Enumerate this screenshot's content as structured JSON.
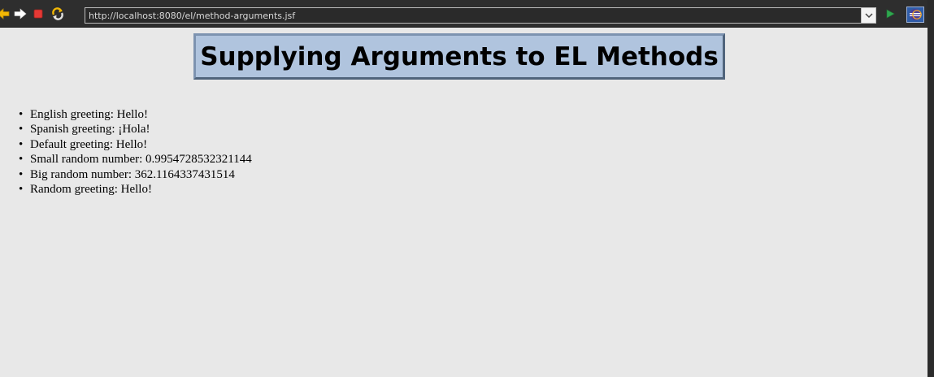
{
  "browser": {
    "url": "http://localhost:8080/el/method-arguments.jsf",
    "icons": {
      "back": "back-arrow-icon",
      "forward": "forward-arrow-icon",
      "stop": "stop-icon",
      "refresh": "refresh-icon",
      "dropdown": "chevron-down-icon",
      "go": "go-play-icon",
      "eclipse": "eclipse-logo-icon"
    },
    "colors": {
      "toolbar": "#2e2e2e",
      "go": "#2fa84f",
      "stop": "#e53935",
      "back": "#f2b705"
    }
  },
  "page": {
    "title": "Supplying Arguments to EL Methods",
    "title_bg": "#b0c4de",
    "items": [
      "English greeting: Hello!",
      "Spanish greeting: ¡Hola!",
      "Default greeting: Hello!",
      "Small random number: 0.9954728532321144",
      "Big random number: 362.1164337431514",
      "Random greeting: Hello!"
    ]
  }
}
